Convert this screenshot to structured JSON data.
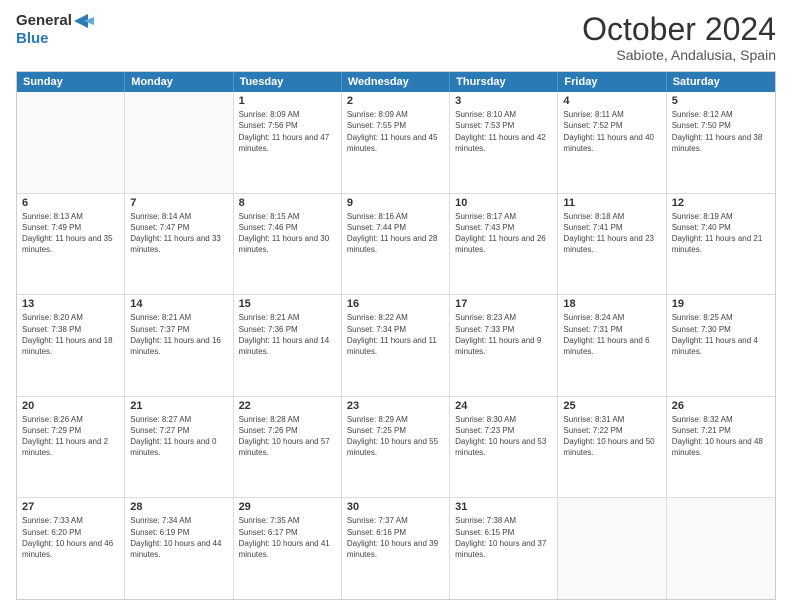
{
  "header": {
    "logo_line1": "General",
    "logo_line2": "Blue",
    "month": "October 2024",
    "location": "Sabiote, Andalusia, Spain"
  },
  "weekdays": [
    "Sunday",
    "Monday",
    "Tuesday",
    "Wednesday",
    "Thursday",
    "Friday",
    "Saturday"
  ],
  "rows": [
    [
      {
        "day": "",
        "text": ""
      },
      {
        "day": "",
        "text": ""
      },
      {
        "day": "1",
        "text": "Sunrise: 8:09 AM\nSunset: 7:56 PM\nDaylight: 11 hours and 47 minutes."
      },
      {
        "day": "2",
        "text": "Sunrise: 8:09 AM\nSunset: 7:55 PM\nDaylight: 11 hours and 45 minutes."
      },
      {
        "day": "3",
        "text": "Sunrise: 8:10 AM\nSunset: 7:53 PM\nDaylight: 11 hours and 42 minutes."
      },
      {
        "day": "4",
        "text": "Sunrise: 8:11 AM\nSunset: 7:52 PM\nDaylight: 11 hours and 40 minutes."
      },
      {
        "day": "5",
        "text": "Sunrise: 8:12 AM\nSunset: 7:50 PM\nDaylight: 11 hours and 38 minutes."
      }
    ],
    [
      {
        "day": "6",
        "text": "Sunrise: 8:13 AM\nSunset: 7:49 PM\nDaylight: 11 hours and 35 minutes."
      },
      {
        "day": "7",
        "text": "Sunrise: 8:14 AM\nSunset: 7:47 PM\nDaylight: 11 hours and 33 minutes."
      },
      {
        "day": "8",
        "text": "Sunrise: 8:15 AM\nSunset: 7:46 PM\nDaylight: 11 hours and 30 minutes."
      },
      {
        "day": "9",
        "text": "Sunrise: 8:16 AM\nSunset: 7:44 PM\nDaylight: 11 hours and 28 minutes."
      },
      {
        "day": "10",
        "text": "Sunrise: 8:17 AM\nSunset: 7:43 PM\nDaylight: 11 hours and 26 minutes."
      },
      {
        "day": "11",
        "text": "Sunrise: 8:18 AM\nSunset: 7:41 PM\nDaylight: 11 hours and 23 minutes."
      },
      {
        "day": "12",
        "text": "Sunrise: 8:19 AM\nSunset: 7:40 PM\nDaylight: 11 hours and 21 minutes."
      }
    ],
    [
      {
        "day": "13",
        "text": "Sunrise: 8:20 AM\nSunset: 7:38 PM\nDaylight: 11 hours and 18 minutes."
      },
      {
        "day": "14",
        "text": "Sunrise: 8:21 AM\nSunset: 7:37 PM\nDaylight: 11 hours and 16 minutes."
      },
      {
        "day": "15",
        "text": "Sunrise: 8:21 AM\nSunset: 7:36 PM\nDaylight: 11 hours and 14 minutes."
      },
      {
        "day": "16",
        "text": "Sunrise: 8:22 AM\nSunset: 7:34 PM\nDaylight: 11 hours and 11 minutes."
      },
      {
        "day": "17",
        "text": "Sunrise: 8:23 AM\nSunset: 7:33 PM\nDaylight: 11 hours and 9 minutes."
      },
      {
        "day": "18",
        "text": "Sunrise: 8:24 AM\nSunset: 7:31 PM\nDaylight: 11 hours and 6 minutes."
      },
      {
        "day": "19",
        "text": "Sunrise: 8:25 AM\nSunset: 7:30 PM\nDaylight: 11 hours and 4 minutes."
      }
    ],
    [
      {
        "day": "20",
        "text": "Sunrise: 8:26 AM\nSunset: 7:29 PM\nDaylight: 11 hours and 2 minutes."
      },
      {
        "day": "21",
        "text": "Sunrise: 8:27 AM\nSunset: 7:27 PM\nDaylight: 11 hours and 0 minutes."
      },
      {
        "day": "22",
        "text": "Sunrise: 8:28 AM\nSunset: 7:26 PM\nDaylight: 10 hours and 57 minutes."
      },
      {
        "day": "23",
        "text": "Sunrise: 8:29 AM\nSunset: 7:25 PM\nDaylight: 10 hours and 55 minutes."
      },
      {
        "day": "24",
        "text": "Sunrise: 8:30 AM\nSunset: 7:23 PM\nDaylight: 10 hours and 53 minutes."
      },
      {
        "day": "25",
        "text": "Sunrise: 8:31 AM\nSunset: 7:22 PM\nDaylight: 10 hours and 50 minutes."
      },
      {
        "day": "26",
        "text": "Sunrise: 8:32 AM\nSunset: 7:21 PM\nDaylight: 10 hours and 48 minutes."
      }
    ],
    [
      {
        "day": "27",
        "text": "Sunrise: 7:33 AM\nSunset: 6:20 PM\nDaylight: 10 hours and 46 minutes."
      },
      {
        "day": "28",
        "text": "Sunrise: 7:34 AM\nSunset: 6:19 PM\nDaylight: 10 hours and 44 minutes."
      },
      {
        "day": "29",
        "text": "Sunrise: 7:35 AM\nSunset: 6:17 PM\nDaylight: 10 hours and 41 minutes."
      },
      {
        "day": "30",
        "text": "Sunrise: 7:37 AM\nSunset: 6:16 PM\nDaylight: 10 hours and 39 minutes."
      },
      {
        "day": "31",
        "text": "Sunrise: 7:38 AM\nSunset: 6:15 PM\nDaylight: 10 hours and 37 minutes."
      },
      {
        "day": "",
        "text": ""
      },
      {
        "day": "",
        "text": ""
      }
    ]
  ]
}
